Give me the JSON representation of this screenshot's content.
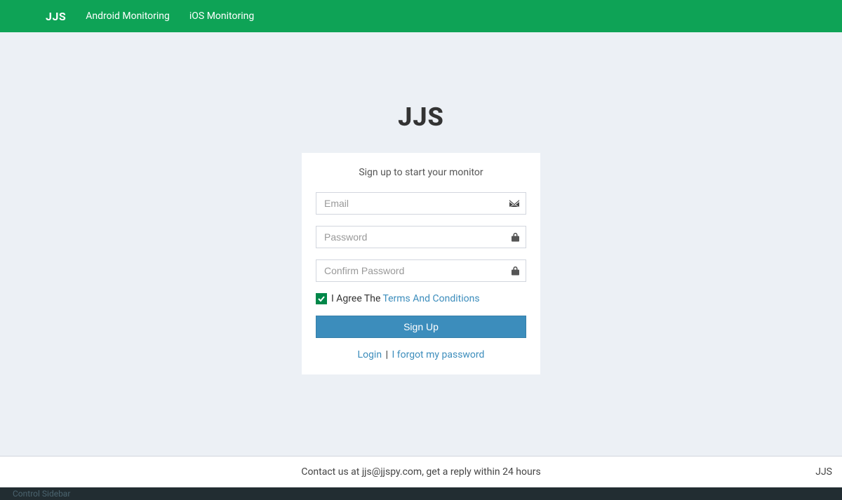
{
  "navbar": {
    "brand": "JJS",
    "links": [
      "Android Monitoring",
      "iOS Monitoring"
    ]
  },
  "logo": "JJS",
  "card": {
    "subtitle": "Sign up to start your monitor",
    "email_placeholder": "Email",
    "password_placeholder": "Password",
    "confirm_placeholder": "Confirm Password",
    "agree_prefix": "I Agree The",
    "terms_link": "Terms And Conditions",
    "signup_button": "Sign Up",
    "login_link": "Login",
    "separator": "|",
    "forgot_link": "I forgot my password"
  },
  "footer": {
    "contact": "Contact us at jjs@jjspy.com, get a reply within 24 hours",
    "right": "JJS"
  },
  "darkbar": "Control Sidebar"
}
